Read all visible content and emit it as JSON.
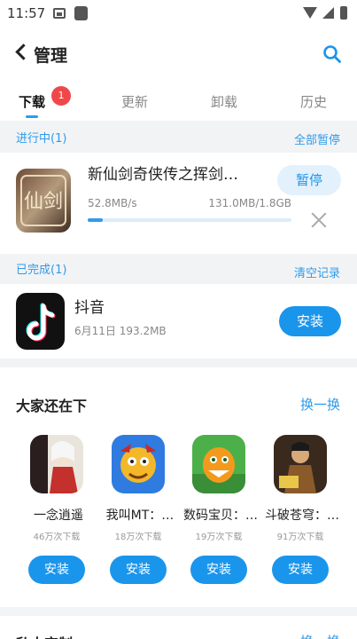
{
  "status_bar": {
    "time": "11:57"
  },
  "header": {
    "title": "管理",
    "back_icon": "back-arrow-icon",
    "search_icon": "search-icon"
  },
  "tabs": [
    {
      "label": "下载",
      "active": true,
      "badge": "1"
    },
    {
      "label": "更新",
      "active": false
    },
    {
      "label": "卸载",
      "active": false
    },
    {
      "label": "历史",
      "active": false
    }
  ],
  "downloading": {
    "section_title": "进行中(1)",
    "action": "全部暂停",
    "item": {
      "name": "新仙剑奇侠传之挥剑…",
      "speed": "52.8MB/s",
      "progress_text": "131.0MB/1.8GB",
      "progress": 0.072,
      "button": "暂停"
    }
  },
  "completed": {
    "section_title": "已完成(1)",
    "action": "清空记录",
    "item": {
      "name": "抖音",
      "meta": "6月11日   193.2MB",
      "button": "安装"
    }
  },
  "recommend": {
    "title": "大家还在下",
    "action": "换一换",
    "items": [
      {
        "name": "一念逍遥",
        "count": "46万次下载",
        "button": "安装"
      },
      {
        "name": "我叫MT：…",
        "count": "18万次下载",
        "button": "安装"
      },
      {
        "name": "数码宝贝：…",
        "count": "19万次下载",
        "button": "安装"
      },
      {
        "name": "斗破苍穹：…",
        "count": "91万次下载",
        "button": "安装"
      }
    ]
  },
  "next_section": {
    "title": "私人定制",
    "action": "换一换"
  },
  "colors": {
    "accent": "#1a95ec",
    "badge": "#f0484a"
  }
}
